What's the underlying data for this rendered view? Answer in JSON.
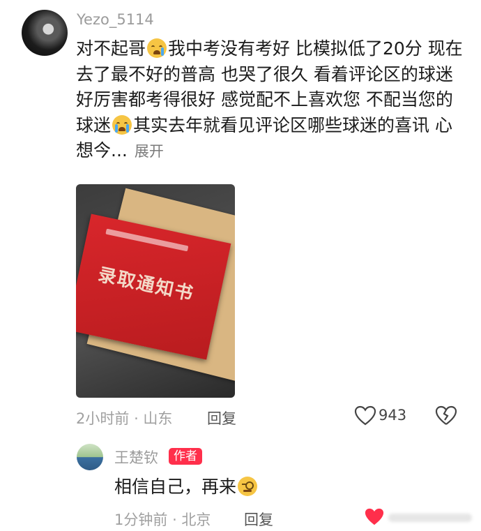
{
  "comment": {
    "username": "Yezo_5114",
    "text_part1": "对不起哥",
    "text_part2": "我中考没有考好 比模拟低了20分 现在去了最不好的普高 也哭了很久 看着评论区的球迷好厉害都考得很好 感觉配不上喜欢您 不配当您的球迷",
    "text_part3": "其实去年就看见评论区哪些球迷的喜讯 心想今...",
    "expand_label": "展开",
    "image": {
      "letter_title": "录取通知书"
    },
    "time": "2小时前",
    "location": "山东",
    "reply_label": "回复",
    "like_count": "943",
    "emoji_icons": [
      "crying-face-icon",
      "loudly-crying-face-icon"
    ]
  },
  "reply": {
    "username": "王楚钦",
    "badge": "作者",
    "text": "相信自己，再来",
    "time": "1分钟前",
    "location": "北京",
    "reply_label": "回复",
    "emoji_icons": [
      "smirking-monocle-face-icon"
    ]
  },
  "colors": {
    "author_badge": "#ff2f4b",
    "liked_heart": "#ff2f4b",
    "meta_text": "#a0a0a0"
  }
}
